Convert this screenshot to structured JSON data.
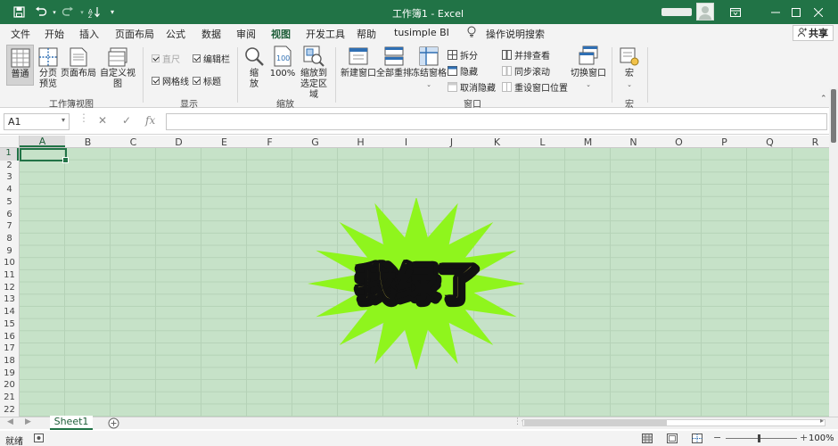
{
  "window": {
    "title": "工作簿1  -  Excel",
    "controls": {
      "minimize_icon": "minimize-icon",
      "restore_icon": "restore-icon",
      "close_icon": "close-icon"
    }
  },
  "quick_access": {
    "save_icon": "save-icon",
    "undo_icon": "undo-icon",
    "redo_icon": "redo-icon",
    "sort_icon": "sort-filter-icon",
    "customize_icon": "chevron-down-icon"
  },
  "tabs": [
    "文件",
    "开始",
    "插入",
    "页面布局",
    "公式",
    "数据",
    "审阅",
    "视图",
    "开发工具",
    "帮助",
    "tusimple BI"
  ],
  "active_tab": "视图",
  "tell_me": {
    "icon": "lightbulb-icon",
    "label": "操作说明搜索"
  },
  "share": {
    "label": "共享",
    "icon": "share-person-icon"
  },
  "ribbon": {
    "workbook_views": {
      "label": "工作簿视图",
      "buttons": [
        {
          "label": "普通",
          "icon": "normal-view-icon",
          "active": true
        },
        {
          "label1": "分页",
          "label2": "预览",
          "icon": "page-break-preview-icon"
        },
        {
          "label": "页面布局",
          "icon": "page-layout-icon"
        },
        {
          "label": "自定义视图",
          "icon": "custom-views-icon"
        }
      ]
    },
    "show": {
      "label": "显示",
      "checks": [
        {
          "label": "直尺",
          "checked": true,
          "disabled": true
        },
        {
          "label": "编辑栏",
          "checked": true,
          "disabled": false
        },
        {
          "label": "网格线",
          "checked": true,
          "disabled": false
        },
        {
          "label": "标题",
          "checked": true,
          "disabled": false
        }
      ]
    },
    "zoom": {
      "label": "缩放",
      "zoom_btn": {
        "label1": "缩",
        "label2": "放",
        "icon": "magnifier-icon"
      },
      "hundred_btn": {
        "label": "100%",
        "icon": "zoom-100-icon"
      },
      "selection_btn": {
        "label1": "缩放到",
        "label2": "选定区域",
        "icon": "zoom-selection-icon"
      }
    },
    "window": {
      "label": "窗口",
      "new_window": {
        "label": "新建窗口",
        "icon": "new-window-icon"
      },
      "arrange_all": {
        "label": "全部重排",
        "icon": "arrange-all-icon"
      },
      "freeze_panes": {
        "label": "冻结窗格",
        "icon": "freeze-panes-icon"
      },
      "split": {
        "label": "拆分",
        "icon": "split-icon"
      },
      "hide": {
        "label": "隐藏",
        "icon": "hide-icon"
      },
      "unhide": {
        "label": "取消隐藏",
        "icon": "unhide-icon",
        "disabled": true
      },
      "side_by_side": {
        "label": "并排查看",
        "icon": "side-by-side-icon"
      },
      "sync_scroll": {
        "label": "同步滚动",
        "icon": "sync-scroll-icon",
        "disabled": true
      },
      "reset_position": {
        "label": "重设窗口位置",
        "icon": "reset-window-icon",
        "disabled": true
      },
      "switch_windows": {
        "label": "切换窗口",
        "icon": "switch-windows-icon"
      }
    },
    "macros": {
      "label": "宏",
      "button": {
        "label": "宏",
        "icon": "macros-icon"
      }
    }
  },
  "formula_bar": {
    "name_box": "A1",
    "cancel_icon": "cancel-x-icon",
    "enter_icon": "checkmark-icon",
    "fx_label": "fx",
    "value": ""
  },
  "columns": [
    "A",
    "B",
    "C",
    "D",
    "E",
    "F",
    "G",
    "H",
    "I",
    "J",
    "K",
    "L",
    "M",
    "N",
    "O",
    "P",
    "Q",
    "R"
  ],
  "rows": [
    "1",
    "2",
    "3",
    "4",
    "5",
    "6",
    "7",
    "8",
    "9",
    "10",
    "11",
    "12",
    "13",
    "14",
    "15",
    "16",
    "17",
    "18",
    "19",
    "20",
    "21",
    "22"
  ],
  "selected_cell": "A1",
  "overlay": {
    "text": "我绿了",
    "burst_color": "#8ff51d",
    "text_color": "#f6e84a",
    "shadow_color": "#111111"
  },
  "colors": {
    "accent": "#217346",
    "grid_tint": "#c6e2c8"
  },
  "sheets": {
    "tabs": [
      "Sheet1"
    ],
    "add_icon": "plus-circle-icon"
  },
  "status": {
    "ready": "就绪",
    "macro_icon": "macro-record-icon",
    "views": [
      "normal-view-icon",
      "page-layout-icon",
      "page-break-preview-icon"
    ],
    "zoom_minus": "−",
    "zoom_plus": "+",
    "zoom": "100%"
  }
}
